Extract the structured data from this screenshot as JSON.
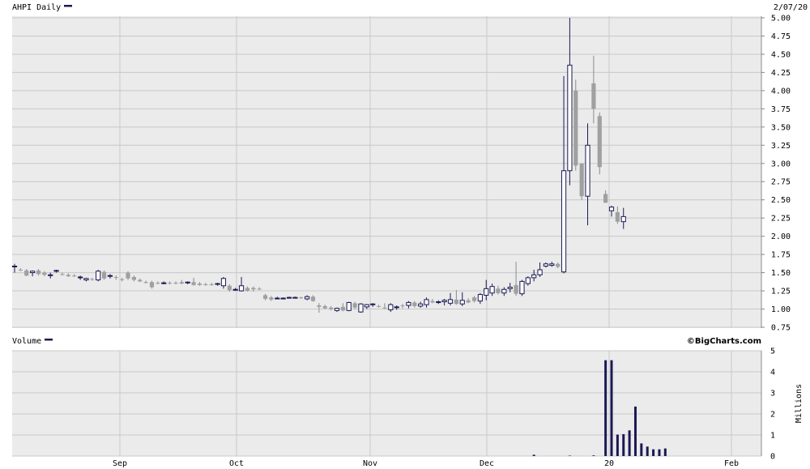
{
  "header": {
    "ticker_label": "AHPI Daily",
    "date_label": "2/07/20"
  },
  "volume_header": {
    "label": "Volume",
    "brand": "©BigCharts.com",
    "units_label": "Millions"
  },
  "colors": {
    "background": "#ffffff",
    "panel_bg": "#ebebeb",
    "grid": "#c8c8c8",
    "up": "#1a1a55",
    "down": "#a0a0a0",
    "volume": "#1a1a55"
  },
  "chart_data": [
    {
      "type": "candlestick",
      "title": "AHPI Daily",
      "date": "2/07/20",
      "y_ticks": [
        "5.00",
        "4.75",
        "4.50",
        "4.25",
        "4.00",
        "3.75",
        "3.50",
        "3.25",
        "3.00",
        "2.75",
        "2.50",
        "2.25",
        "2.00",
        "1.75",
        "1.50",
        "1.25",
        "1.00",
        "0.75"
      ],
      "ylim": [
        0.75,
        5.0
      ],
      "x_ticks": [
        "Sep",
        "Oct",
        "Nov",
        "Dec",
        "20",
        "Feb"
      ],
      "grid": true,
      "candles": [
        {
          "o": 1.58,
          "h": 1.62,
          "l": 1.5,
          "c": 1.59
        },
        {
          "o": 1.54,
          "h": 1.56,
          "l": 1.52,
          "c": 1.53
        },
        {
          "o": 1.53,
          "h": 1.55,
          "l": 1.45,
          "c": 1.46
        },
        {
          "o": 1.5,
          "h": 1.53,
          "l": 1.45,
          "c": 1.52
        },
        {
          "o": 1.53,
          "h": 1.55,
          "l": 1.46,
          "c": 1.48
        },
        {
          "o": 1.5,
          "h": 1.52,
          "l": 1.45,
          "c": 1.47
        },
        {
          "o": 1.47,
          "h": 1.5,
          "l": 1.42,
          "c": 1.47
        },
        {
          "o": 1.52,
          "h": 1.54,
          "l": 1.5,
          "c": 1.53
        },
        {
          "o": 1.48,
          "h": 1.5,
          "l": 1.46,
          "c": 1.47
        },
        {
          "o": 1.47,
          "h": 1.49,
          "l": 1.44,
          "c": 1.45
        },
        {
          "o": 1.46,
          "h": 1.48,
          "l": 1.44,
          "c": 1.45
        },
        {
          "o": 1.44,
          "h": 1.46,
          "l": 1.4,
          "c": 1.44
        },
        {
          "o": 1.4,
          "h": 1.43,
          "l": 1.38,
          "c": 1.42
        },
        {
          "o": 1.41,
          "h": 1.43,
          "l": 1.39,
          "c": 1.4
        },
        {
          "o": 1.4,
          "h": 1.54,
          "l": 1.38,
          "c": 1.52
        },
        {
          "o": 1.51,
          "h": 1.53,
          "l": 1.4,
          "c": 1.42
        },
        {
          "o": 1.45,
          "h": 1.48,
          "l": 1.42,
          "c": 1.46
        },
        {
          "o": 1.44,
          "h": 1.46,
          "l": 1.4,
          "c": 1.43
        },
        {
          "o": 1.41,
          "h": 1.43,
          "l": 1.38,
          "c": 1.4
        },
        {
          "o": 1.5,
          "h": 1.52,
          "l": 1.4,
          "c": 1.42
        },
        {
          "o": 1.44,
          "h": 1.46,
          "l": 1.38,
          "c": 1.4
        },
        {
          "o": 1.4,
          "h": 1.42,
          "l": 1.37,
          "c": 1.38
        },
        {
          "o": 1.37,
          "h": 1.39,
          "l": 1.35,
          "c": 1.36
        },
        {
          "o": 1.37,
          "h": 1.39,
          "l": 1.28,
          "c": 1.3
        },
        {
          "o": 1.36,
          "h": 1.38,
          "l": 1.34,
          "c": 1.35
        },
        {
          "o": 1.36,
          "h": 1.38,
          "l": 1.34,
          "c": 1.36
        },
        {
          "o": 1.36,
          "h": 1.38,
          "l": 1.34,
          "c": 1.35
        },
        {
          "o": 1.36,
          "h": 1.38,
          "l": 1.34,
          "c": 1.35
        },
        {
          "o": 1.37,
          "h": 1.4,
          "l": 1.34,
          "c": 1.35
        },
        {
          "o": 1.36,
          "h": 1.38,
          "l": 1.34,
          "c": 1.37
        },
        {
          "o": 1.37,
          "h": 1.43,
          "l": 1.32,
          "c": 1.33
        },
        {
          "o": 1.35,
          "h": 1.37,
          "l": 1.32,
          "c": 1.33
        },
        {
          "o": 1.34,
          "h": 1.36,
          "l": 1.32,
          "c": 1.33
        },
        {
          "o": 1.34,
          "h": 1.36,
          "l": 1.32,
          "c": 1.33
        },
        {
          "o": 1.34,
          "h": 1.36,
          "l": 1.32,
          "c": 1.35
        },
        {
          "o": 1.32,
          "h": 1.44,
          "l": 1.28,
          "c": 1.42
        },
        {
          "o": 1.32,
          "h": 1.34,
          "l": 1.24,
          "c": 1.26
        },
        {
          "o": 1.27,
          "h": 1.29,
          "l": 1.25,
          "c": 1.27
        },
        {
          "o": 1.25,
          "h": 1.44,
          "l": 1.24,
          "c": 1.32
        },
        {
          "o": 1.29,
          "h": 1.31,
          "l": 1.24,
          "c": 1.25
        },
        {
          "o": 1.29,
          "h": 1.31,
          "l": 1.24,
          "c": 1.27
        },
        {
          "o": 1.28,
          "h": 1.3,
          "l": 1.26,
          "c": 1.27
        },
        {
          "o": 1.19,
          "h": 1.21,
          "l": 1.12,
          "c": 1.14
        },
        {
          "o": 1.16,
          "h": 1.18,
          "l": 1.11,
          "c": 1.13
        },
        {
          "o": 1.15,
          "h": 1.17,
          "l": 1.14,
          "c": 1.15
        },
        {
          "o": 1.15,
          "h": 1.16,
          "l": 1.14,
          "c": 1.15
        },
        {
          "o": 1.16,
          "h": 1.17,
          "l": 1.15,
          "c": 1.16
        },
        {
          "o": 1.16,
          "h": 1.17,
          "l": 1.15,
          "c": 1.16
        },
        {
          "o": 1.16,
          "h": 1.17,
          "l": 1.14,
          "c": 1.15
        },
        {
          "o": 1.14,
          "h": 1.19,
          "l": 1.12,
          "c": 1.17
        },
        {
          "o": 1.17,
          "h": 1.19,
          "l": 1.1,
          "c": 1.11
        },
        {
          "o": 1.05,
          "h": 1.08,
          "l": 0.95,
          "c": 1.03
        },
        {
          "o": 1.04,
          "h": 1.06,
          "l": 1.0,
          "c": 1.01
        },
        {
          "o": 1.02,
          "h": 1.04,
          "l": 0.98,
          "c": 1.0
        },
        {
          "o": 0.98,
          "h": 1.02,
          "l": 0.96,
          "c": 1.01
        },
        {
          "o": 1.03,
          "h": 1.08,
          "l": 0.97,
          "c": 0.98
        },
        {
          "o": 0.98,
          "h": 1.1,
          "l": 0.97,
          "c": 1.09
        },
        {
          "o": 1.08,
          "h": 1.1,
          "l": 1.0,
          "c": 1.02
        },
        {
          "o": 0.96,
          "h": 1.08,
          "l": 0.95,
          "c": 1.07
        },
        {
          "o": 1.03,
          "h": 1.07,
          "l": 1.0,
          "c": 1.06
        },
        {
          "o": 1.06,
          "h": 1.08,
          "l": 1.03,
          "c": 1.07
        },
        {
          "o": 1.04,
          "h": 1.06,
          "l": 1.02,
          "c": 1.03
        },
        {
          "o": 1.02,
          "h": 1.08,
          "l": 1.0,
          "c": 1.01
        },
        {
          "o": 0.99,
          "h": 1.08,
          "l": 0.96,
          "c": 1.06
        },
        {
          "o": 1.02,
          "h": 1.05,
          "l": 0.99,
          "c": 1.03
        },
        {
          "o": 1.05,
          "h": 1.07,
          "l": 1.01,
          "c": 1.04
        },
        {
          "o": 1.05,
          "h": 1.11,
          "l": 1.01,
          "c": 1.09
        },
        {
          "o": 1.09,
          "h": 1.11,
          "l": 1.02,
          "c": 1.04
        },
        {
          "o": 1.04,
          "h": 1.1,
          "l": 1.02,
          "c": 1.07
        },
        {
          "o": 1.06,
          "h": 1.16,
          "l": 1.02,
          "c": 1.13
        },
        {
          "o": 1.11,
          "h": 1.14,
          "l": 1.08,
          "c": 1.09
        },
        {
          "o": 1.09,
          "h": 1.12,
          "l": 1.07,
          "c": 1.1
        },
        {
          "o": 1.1,
          "h": 1.14,
          "l": 1.05,
          "c": 1.12
        },
        {
          "o": 1.08,
          "h": 1.22,
          "l": 1.05,
          "c": 1.13
        },
        {
          "o": 1.13,
          "h": 1.26,
          "l": 1.06,
          "c": 1.07
        },
        {
          "o": 1.07,
          "h": 1.23,
          "l": 1.04,
          "c": 1.12
        },
        {
          "o": 1.12,
          "h": 1.15,
          "l": 1.08,
          "c": 1.09
        },
        {
          "o": 1.16,
          "h": 1.18,
          "l": 1.09,
          "c": 1.11
        },
        {
          "o": 1.11,
          "h": 1.22,
          "l": 1.07,
          "c": 1.2
        },
        {
          "o": 1.19,
          "h": 1.4,
          "l": 1.12,
          "c": 1.28
        },
        {
          "o": 1.22,
          "h": 1.35,
          "l": 1.18,
          "c": 1.31
        },
        {
          "o": 1.28,
          "h": 1.32,
          "l": 1.2,
          "c": 1.22
        },
        {
          "o": 1.22,
          "h": 1.3,
          "l": 1.18,
          "c": 1.27
        },
        {
          "o": 1.28,
          "h": 1.36,
          "l": 1.23,
          "c": 1.3
        },
        {
          "o": 1.33,
          "h": 1.65,
          "l": 1.18,
          "c": 1.21
        },
        {
          "o": 1.21,
          "h": 1.4,
          "l": 1.18,
          "c": 1.38
        },
        {
          "o": 1.35,
          "h": 1.45,
          "l": 1.32,
          "c": 1.43
        },
        {
          "o": 1.43,
          "h": 1.54,
          "l": 1.38,
          "c": 1.47
        },
        {
          "o": 1.47,
          "h": 1.64,
          "l": 1.44,
          "c": 1.54
        },
        {
          "o": 1.59,
          "h": 1.64,
          "l": 1.57,
          "c": 1.62
        },
        {
          "o": 1.6,
          "h": 1.65,
          "l": 1.58,
          "c": 1.62
        },
        {
          "o": 1.62,
          "h": 1.64,
          "l": 1.56,
          "c": 1.58
        },
        {
          "o": 1.51,
          "h": 4.2,
          "l": 1.49,
          "c": 2.9
        },
        {
          "o": 2.9,
          "h": 5.0,
          "l": 2.7,
          "c": 4.35
        },
        {
          "o": 4.0,
          "h": 4.15,
          "l": 2.9,
          "c": 2.97
        },
        {
          "o": 3.0,
          "h": 3.0,
          "l": 2.5,
          "c": 2.55
        },
        {
          "o": 2.55,
          "h": 3.55,
          "l": 2.15,
          "c": 3.25
        },
        {
          "o": 4.1,
          "h": 4.48,
          "l": 3.55,
          "c": 3.75
        },
        {
          "o": 3.65,
          "h": 3.7,
          "l": 2.85,
          "c": 2.95
        },
        {
          "o": 2.58,
          "h": 2.63,
          "l": 2.46,
          "c": 2.46
        },
        {
          "o": 2.35,
          "h": 2.42,
          "l": 2.27,
          "c": 2.4
        },
        {
          "o": 2.33,
          "h": 2.41,
          "l": 2.17,
          "c": 2.2
        },
        {
          "o": 2.2,
          "h": 2.39,
          "l": 2.1,
          "c": 2.27
        }
      ]
    },
    {
      "type": "bar",
      "title": "Volume",
      "ylabel": "Millions",
      "y_ticks": [
        "5",
        "4",
        "3",
        "2",
        "1",
        "0"
      ],
      "ylim": [
        0,
        5
      ],
      "volume_bars": [
        {
          "i": 87,
          "v": 0.06
        },
        {
          "i": 93,
          "v": 0.02
        },
        {
          "i": 97,
          "v": 0.03
        },
        {
          "i": 99,
          "v": 4.55
        },
        {
          "i": 100,
          "v": 4.55
        },
        {
          "i": 101,
          "v": 1.02
        },
        {
          "i": 102,
          "v": 1.04
        },
        {
          "i": 103,
          "v": 1.22
        },
        {
          "i": 104,
          "v": 2.35
        },
        {
          "i": 105,
          "v": 0.6
        },
        {
          "i": 106,
          "v": 0.45
        },
        {
          "i": 107,
          "v": 0.32
        },
        {
          "i": 108,
          "v": 0.32
        },
        {
          "i": 109,
          "v": 0.36
        }
      ]
    }
  ]
}
